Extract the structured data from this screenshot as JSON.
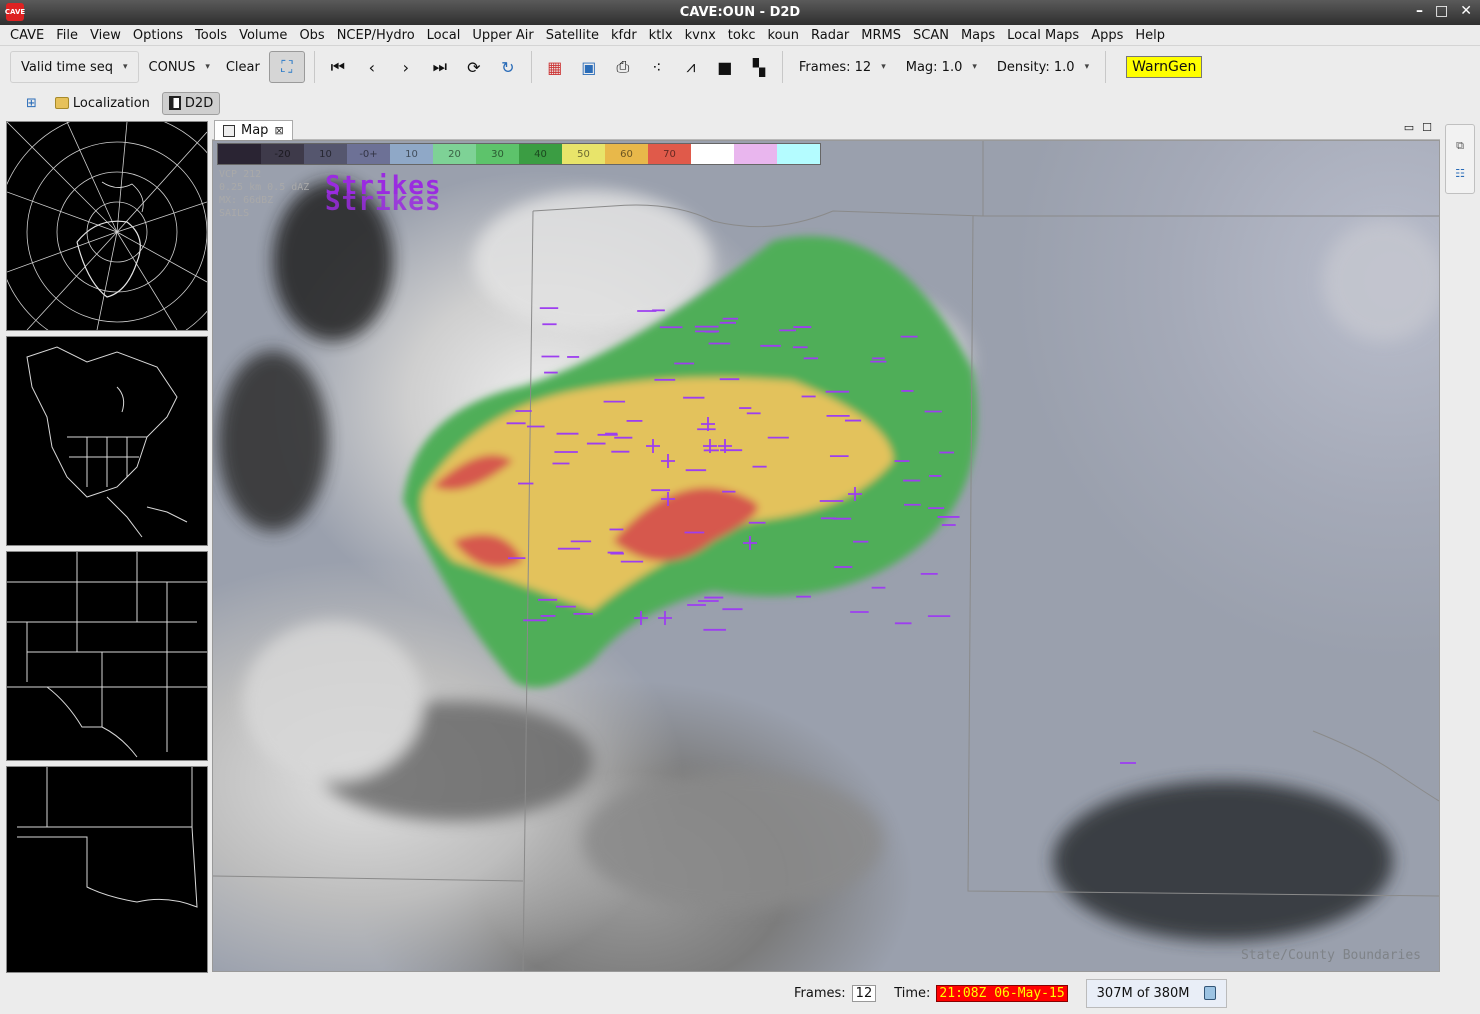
{
  "window": {
    "title": "CAVE:OUN - D2D",
    "logo": "CAVE"
  },
  "menu": [
    "CAVE",
    "File",
    "View",
    "Options",
    "Tools",
    "Volume",
    "Obs",
    "NCEP/Hydro",
    "Local",
    "Upper Air",
    "Satellite",
    "kfdr",
    "ktlx",
    "kvnx",
    "tokc",
    "koun",
    "Radar",
    "MRMS",
    "SCAN",
    "Maps",
    "Local Maps",
    "Apps",
    "Help"
  ],
  "toolbar": {
    "time_mode": "Valid time seq",
    "scale": "CONUS",
    "clear": "Clear",
    "frames": "Frames: 12",
    "mag": "Mag: 1.0",
    "density": "Density: 1.0",
    "warngen": "WarnGen",
    "buttons": [
      "fullscreen-icon",
      "first-frame-icon",
      "previous-frame-icon",
      "next-frame-icon",
      "last-frame-icon",
      "loop-icon",
      "refresh-icon",
      "image-props-icon",
      "map-props-icon",
      "print-icon",
      "points-icon",
      "baseline-icon",
      "single-panel-icon",
      "four-panel-icon"
    ]
  },
  "perspectives": {
    "localization": "Localization",
    "d2d": "D2D"
  },
  "map": {
    "tab_label": "Map",
    "colorbar_labels": [
      "-20",
      "10",
      "-0+",
      "10",
      "20",
      "30",
      "40",
      "50",
      "60",
      "70"
    ],
    "colorbar_colors": [
      "#2a2433",
      "#3e3a4a",
      "#55566e",
      "#6d7196",
      "#8fa8c7",
      "#7ed296",
      "#5dc36b",
      "#3b9d43",
      "#e8e46a",
      "#e8b84a",
      "#e05a4a",
      "#ffffff",
      "#e9b6ee",
      "#b4fcff"
    ],
    "legend_lines": [
      "VCP 212",
      "0.25 km 0.5 dAZ",
      "MX: 66dBZ",
      "SAILS"
    ],
    "strikes_lines": [
      "Strikes",
      "Strikes"
    ],
    "boundaries": "State/County Boundaries"
  },
  "status": {
    "frames_label": "Frames:",
    "frames_value": "12",
    "time_label": "Time:",
    "time_value": "21:08Z 06-May-15",
    "memory": "307M of 380M"
  }
}
